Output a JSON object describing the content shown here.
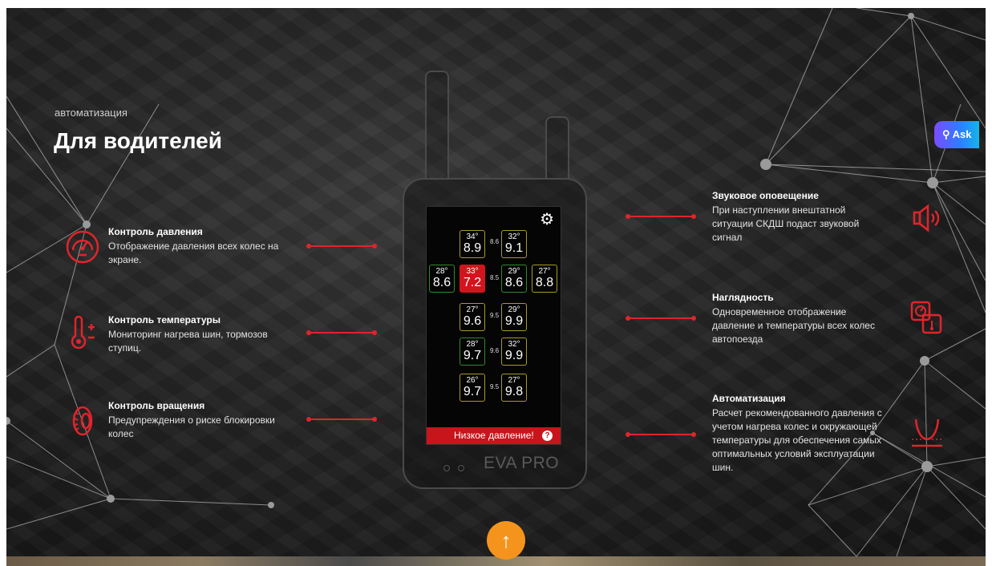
{
  "section": {
    "eyebrow": "автоматизация",
    "title": "Для водителей"
  },
  "features_left": [
    {
      "title": "Контроль давления",
      "desc": "Отображение давления всех колес на экране.",
      "icon": "pressure-gauge-icon"
    },
    {
      "title": "Контроль температуры",
      "desc": "Мониторинг нагрева шин, тормозов ступиц.",
      "icon": "thermometer-icon"
    },
    {
      "title": "Контроль вращения",
      "desc": "Предупреждения о риске блокировки колес",
      "icon": "wheel-rotation-icon"
    }
  ],
  "features_right": [
    {
      "title": "Звуковое оповещение",
      "desc": "При наступлении внештатной ситуации СКДШ подаст звуковой сигнал",
      "icon": "speaker-icon"
    },
    {
      "title": "Наглядность",
      "desc": "Одновременное отображение давление и температуры всех колес автопоезда",
      "icon": "dashboard-icon"
    },
    {
      "title": "Автоматизация",
      "desc": "Расчет рекомендованного давления с учетом нагрева колес и окружающей температуры для обеспечения самых оптимальных условий эксплуатации шин.",
      "icon": "automation-curve-icon"
    }
  ],
  "device": {
    "brand": "EVA PRO",
    "alert": "Низкое давление!",
    "alert_help": "?",
    "gear_icon": "⚙",
    "tiles": [
      {
        "temp": "34°",
        "press": "8.9",
        "status": "yellow"
      },
      {
        "temp": "32°",
        "press": "9.1",
        "status": "yellow"
      },
      {
        "temp": "28°",
        "press": "8.6",
        "status": "green"
      },
      {
        "temp": "33°",
        "press": "7.2",
        "status": "red"
      },
      {
        "temp": "29°",
        "press": "8.6",
        "status": "green"
      },
      {
        "temp": "27°",
        "press": "8.8",
        "status": "yellow"
      },
      {
        "temp": "27°",
        "press": "9.6",
        "status": "yellow"
      },
      {
        "temp": "29°",
        "press": "9.9",
        "status": "yellow"
      },
      {
        "temp": "28°",
        "press": "9.7",
        "status": "green"
      },
      {
        "temp": "32°",
        "press": "9.9",
        "status": "yellow"
      },
      {
        "temp": "26°",
        "press": "9.7",
        "status": "yellow"
      },
      {
        "temp": "27°",
        "press": "9.8",
        "status": "yellow"
      }
    ],
    "axles": [
      "8.6",
      "8.5",
      "9.5",
      "9.6",
      "9.5"
    ]
  },
  "widgets": {
    "ask_label": "Ask",
    "scroll_up_icon": "↑"
  },
  "colors": {
    "accent_red": "#e0242b",
    "scroll_button": "#f5941c",
    "tile_green": "#2e8a2a",
    "tile_yellow": "#a79a24"
  }
}
